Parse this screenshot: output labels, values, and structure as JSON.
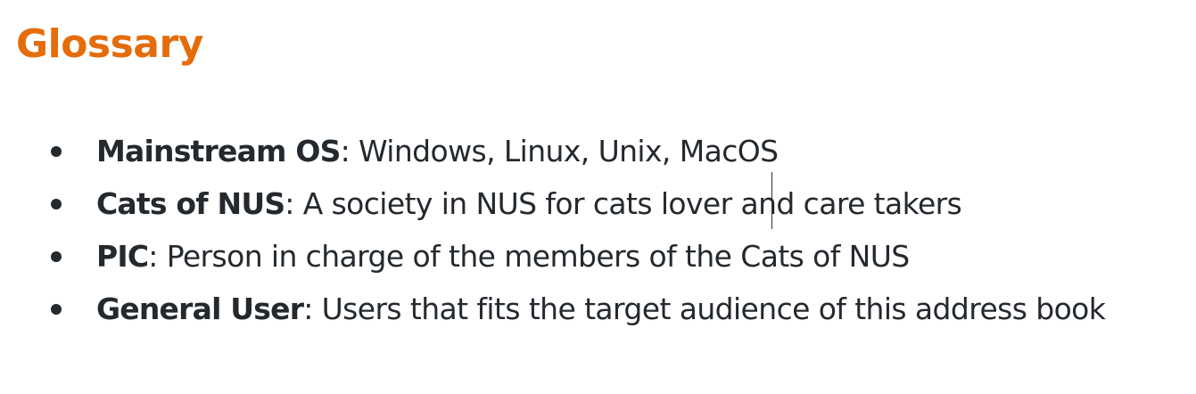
{
  "heading": "Glossary",
  "items": [
    {
      "term": "Mainstream OS",
      "separator": ":",
      "definition": " Windows, Linux, Unix, MacOS"
    },
    {
      "term": "Cats of NUS",
      "separator": ":",
      "definition": " A society in NUS for cats lover and care takers"
    },
    {
      "term": "PIC",
      "separator": ":",
      "definition": " Person in charge of the members of the Cats of NUS"
    },
    {
      "term": "General User",
      "separator": ":",
      "definition": " Users that fits the target audience of this address book"
    }
  ],
  "colors": {
    "heading": "#e46c0a",
    "text": "#24292e"
  }
}
